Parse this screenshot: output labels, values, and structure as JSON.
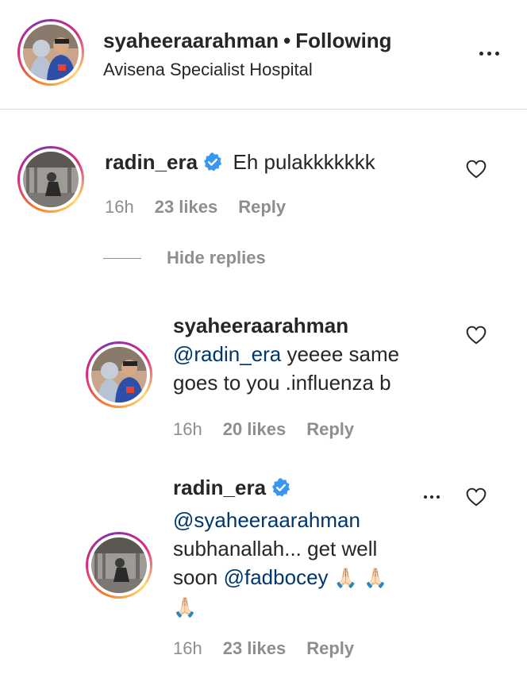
{
  "header": {
    "username": "syaheeraarahman",
    "separator": "•",
    "follow_status": "Following",
    "location": "Avisena Specialist Hospital"
  },
  "comments": [
    {
      "username": "radin_era",
      "verified": true,
      "text": "Eh pulakkkkkkk",
      "time": "16h",
      "likes": "23 likes",
      "reply": "Reply"
    }
  ],
  "hide_replies": "Hide replies",
  "replies": [
    {
      "username": "syaheeraarahman",
      "verified": false,
      "mention": "@radin_era",
      "text_line1": " yeeee same",
      "text_line2": "goes to you .influenza b",
      "time": "16h",
      "likes": "20 likes",
      "reply": "Reply"
    },
    {
      "username": "radin_era",
      "verified": true,
      "mention": "@syaheeraarahman",
      "text_line1": "subhanallah... get well",
      "text_line2_prefix": "soon ",
      "mention2": "@fadbocey",
      "emoji": "🙏🏻 🙏🏻",
      "emoji2": "🙏🏻",
      "time": "16h",
      "likes": "23 likes",
      "reply": "Reply"
    }
  ],
  "icons": {
    "more": "more-horizontal-icon",
    "heart": "heart-outline-icon",
    "verified": "verified-badge-icon"
  },
  "colors": {
    "text": "#262626",
    "meta": "#8e8e8e",
    "mention": "#00376b",
    "verified": "#3897f0"
  }
}
